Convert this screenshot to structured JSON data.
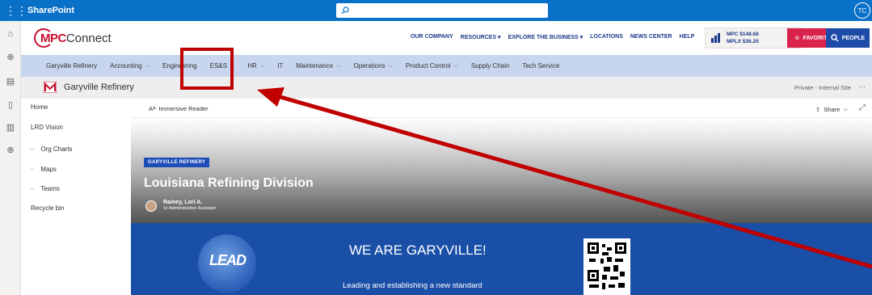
{
  "suite": {
    "app_name": "SharePoint",
    "avatar_initials": "TC"
  },
  "hub": {
    "logo_mpc": "MPC",
    "logo_connect": "Connect",
    "nav": [
      "OUR COMPANY",
      "RESOURCES ▾",
      "EXPLORE THE BUSINESS ▾",
      "LOCATIONS",
      "NEWS CENTER",
      "HELP"
    ],
    "stock": {
      "mpc": "MPC $148.68",
      "mplx": "MPLX $36.20"
    },
    "favorites_label": "FAVORITES",
    "people_label": "PEOPLE"
  },
  "navbar": {
    "items": [
      {
        "label": "Garyville Refinery",
        "chev": false
      },
      {
        "label": "Accounting",
        "chev": true
      },
      {
        "label": "Engineering",
        "chev": false
      },
      {
        "label": "ES&S",
        "chev": true
      },
      {
        "label": "HR",
        "chev": true
      },
      {
        "label": "IT",
        "chev": false
      },
      {
        "label": "Maintenance",
        "chev": true
      },
      {
        "label": "Operations",
        "chev": true
      },
      {
        "label": "Product Control",
        "chev": true
      },
      {
        "label": "Supply Chain",
        "chev": false
      },
      {
        "label": "Tech Service",
        "chev": false
      }
    ]
  },
  "site": {
    "title": "Garyville Refinery",
    "privacy": "Private - Internal Site",
    "more": "···"
  },
  "leftnav": {
    "items": [
      {
        "label": "Home",
        "chev": false
      },
      {
        "label": "LRD Vision",
        "chev": false
      },
      {
        "label": "Org Charts",
        "chev": true
      },
      {
        "label": "Maps",
        "chev": true
      },
      {
        "label": "Teams",
        "chev": true
      },
      {
        "label": "Recycle bin",
        "chev": false
      }
    ]
  },
  "cmdbar": {
    "reader_label": "Immersive Reader",
    "share_label": "Share"
  },
  "hero": {
    "tag": "GARYVILLE REFINERY",
    "title": "Louisiana Refining Division",
    "author_name": "Rainey, Lori A.",
    "author_role": "Sr Administrative Assistant"
  },
  "banner": {
    "lead_text": "LEAD",
    "title": "WE ARE GARYVILLE!",
    "subtitle": "Leading and establishing a new standard"
  },
  "colors": {
    "suitebar": "#0a71c8",
    "navbar": "#c7d6ee",
    "banner": "#1a4fa7",
    "favorites": "#d9224c",
    "people": "#1d4ba8",
    "annotation": "#c00000"
  }
}
